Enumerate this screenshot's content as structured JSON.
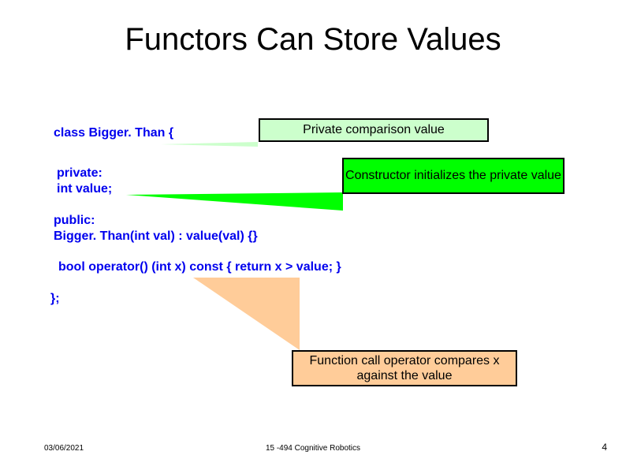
{
  "title": "Functors Can Store Values",
  "code": {
    "line1": "class Bigger. Than {",
    "line2a": "private:",
    "line2b": " int value;",
    "line3a": "public:",
    "line3b": " Bigger. Than(int val) : value(val) {}",
    "line4": "bool operator() (int x) const { return x > value; }",
    "line5": "};"
  },
  "callouts": {
    "c1": "Private comparison value",
    "c2": "Constructor initializes the private value",
    "c3": "Function call operator compares x against the value"
  },
  "footer": {
    "date": "03/06/2021",
    "center": "15 -494 Cognitive Robotics",
    "page": "4"
  }
}
